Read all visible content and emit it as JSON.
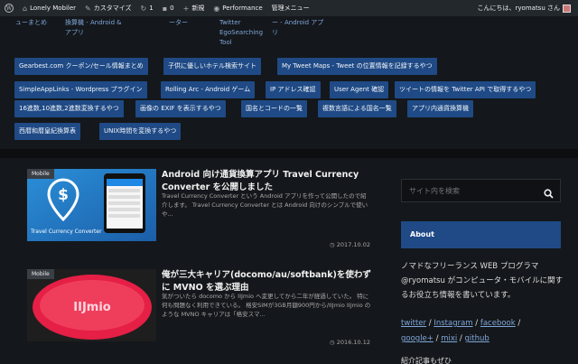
{
  "adminbar": {
    "site_name": "Lonely Mobiler",
    "customize": "カスタマイズ",
    "updates_count": "1",
    "comments_count": "0",
    "new_label": "新規",
    "performance": "Performance",
    "admin_menu": "管理メニュー",
    "greeting": "こんにちは、ryomatsu さん"
  },
  "topnav": [
    {
      "line1": "ューまとめ",
      "line2": ""
    },
    {
      "line1": "換算機 - Android",
      "line2": "アプリ"
    },
    {
      "line1": "& ",
      "line2": ""
    },
    {
      "line1": "ーター",
      "line2": ""
    },
    {
      "line1": "Twitter",
      "line2": "EgoSearching",
      "line3": "Tool"
    },
    {
      "line1": "ー - Android アプ",
      "line2": "リ"
    }
  ],
  "tags": [
    "Gearbest.com クーポン/セール情報まとめ",
    "子供に優しいホテル検索サイト",
    "My Tweet Maps - Tweet の位置情報を記録するやつ",
    "SimpleAppLinks - Wordpress プラグイン",
    "Rolling Arc - Android ゲーム",
    "IP アドレス確認",
    "User Agent 確認",
    "ツイートの情報を Twitter API で取得するやつ",
    "16進数,10進数,2進数変換するやつ",
    "画像の EXIF を表示するやつ",
    "国名とコードの一覧",
    "複数言語による国名一覧",
    "アプリ内通貨換算機",
    "西暦和暦皇紀換算表",
    "UNIX時間を変換するやつ"
  ],
  "posts": [
    {
      "category": "Mobile",
      "title": "Android 向け通貨換算アプリ Travel Currency Converter を公開しました",
      "excerpt": "Travel Currency Converter という Android アプリを作って公開したので紹介します。 Travel Currency Converter とは Android 向けのシンプルで使いや...",
      "date": "2017.10.02",
      "thumb_text": "Travel Currency Converter"
    },
    {
      "category": "Mobile",
      "title": "俺が三大キャリア(docomo/au/softbank)を使わずに MVNO を選ぶ理由",
      "excerpt": "気がついたら docomo から IIJmio へ変更してから二年が経過していた。 特に何も問題なく利用できている。 格安SIMが3GB月額900円から/IIJmio IIJmio のような MVNO キャリアは「格安スマ...",
      "date": "2016.10.12",
      "thumb_text": "IIJmio"
    }
  ],
  "sidebar": {
    "search_placeholder": "サイト内を検索",
    "about_title": "About",
    "about_text": "ノマドなフリーランス WEB プログラマ @ryomatsu がコンピュータ・モバイルに関するお役立ち情報を書いています。",
    "links": [
      "twitter",
      "Instagram",
      "facebook",
      "google+",
      "mixi",
      "github"
    ],
    "more": "紹介記事もぜひ"
  },
  "colors": {
    "accent": "#1f4a85",
    "background": "#14171b",
    "link": "#7fa7d9"
  }
}
